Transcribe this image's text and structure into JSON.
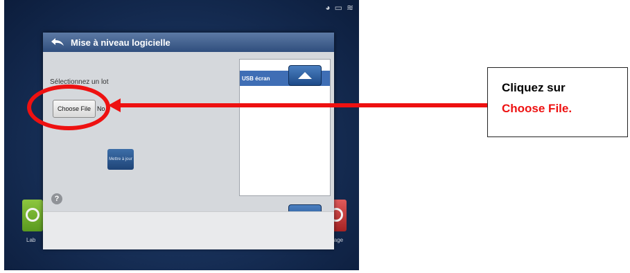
{
  "dialog": {
    "title": "Mise à niveau logicielle",
    "prompt_label": "Sélectionnez un lot",
    "choose_file_label": "Choose File",
    "file_status_text": "No",
    "update_button_label": "Mettre à jour",
    "list_items": [
      "USB écran"
    ],
    "help_label": "?"
  },
  "background": {
    "left_tile_label": "Lab",
    "right_tile_label": "lage"
  },
  "callout": {
    "line1": "Cliquez sur",
    "line2": "Choose File."
  },
  "colors": {
    "annotation_red": "#ee1111",
    "header_blue": "#2f4e7d",
    "selected_item_blue": "#3f6eb5"
  },
  "icons": [
    "back-arrow-icon",
    "help-icon",
    "chevron-up-icon",
    "chevron-down-icon",
    "status-icons"
  ]
}
